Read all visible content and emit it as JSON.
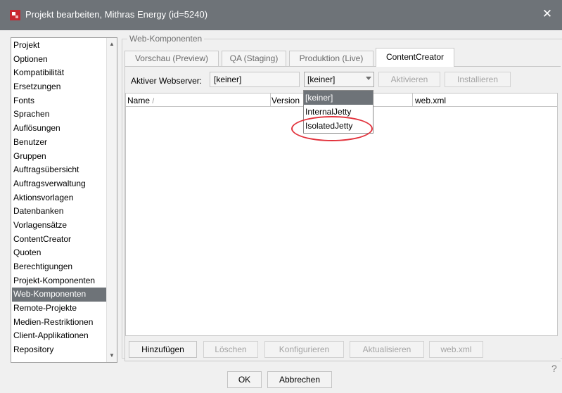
{
  "window": {
    "title": "Projekt bearbeiten, Mithras Energy (id=5240)",
    "close_glyph": "✕",
    "app_icon": "project-edit-icon"
  },
  "sidebar": {
    "items": [
      {
        "label": "Projekt"
      },
      {
        "label": "Optionen"
      },
      {
        "label": "Kompatibilität"
      },
      {
        "label": "Ersetzungen"
      },
      {
        "label": "Fonts"
      },
      {
        "label": "Sprachen"
      },
      {
        "label": "Auflösungen"
      },
      {
        "label": "Benutzer"
      },
      {
        "label": "Gruppen"
      },
      {
        "label": "Auftragsübersicht"
      },
      {
        "label": "Auftragsverwaltung"
      },
      {
        "label": "Aktionsvorlagen"
      },
      {
        "label": "Datenbanken"
      },
      {
        "label": "Vorlagensätze"
      },
      {
        "label": "ContentCreator"
      },
      {
        "label": "Quoten"
      },
      {
        "label": "Berechtigungen"
      },
      {
        "label": "Projekt-Komponenten"
      },
      {
        "label": "Web-Komponenten",
        "selected": true
      },
      {
        "label": "Remote-Projekte"
      },
      {
        "label": "Medien-Restriktionen"
      },
      {
        "label": "Client-Applikationen"
      },
      {
        "label": "Repository"
      }
    ],
    "scroll_up": "▲",
    "scroll_down": "▼"
  },
  "group": {
    "title": "Web-Komponenten"
  },
  "tabs": [
    {
      "label": "Vorschau (Preview)"
    },
    {
      "label": "QA (Staging)"
    },
    {
      "label": "Produktion (Live)"
    },
    {
      "label": "ContentCreator",
      "active": true
    }
  ],
  "webserver": {
    "label": "Aktiver Webserver:",
    "current_value": "[keiner]",
    "select_value": "[keiner]",
    "activate_label": "Aktivieren",
    "install_label": "Installieren",
    "options": [
      "[keiner]",
      "InternalJetty",
      "IsolatedJetty"
    ],
    "highlighted_option": "[keiner]"
  },
  "table": {
    "columns": [
      "Name",
      "Version",
      "web.xml"
    ],
    "sort_indicator": "/",
    "rows": []
  },
  "actions": {
    "add": "Hinzufügen",
    "delete": "Löschen",
    "configure": "Konfigurieren",
    "update": "Aktualisieren",
    "webxml": "web.xml"
  },
  "footer": {
    "ok": "OK",
    "cancel": "Abbrechen",
    "help": "?"
  },
  "colors": {
    "titlebar": "#6e7378",
    "selection": "#6e7378",
    "annotation": "#e2333d",
    "app_icon": "#c8262f"
  }
}
